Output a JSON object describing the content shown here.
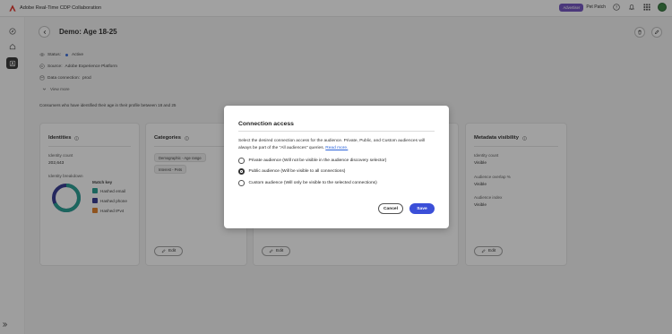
{
  "app": {
    "title": "Adobe Real-Time CDP Collaboration",
    "logo_icon": "adobe-logo-icon",
    "brand_color": "#e1251b"
  },
  "topbar": {
    "badge": "Advertiser",
    "org_name": "Pet Patch",
    "badge_color": "#6b4bbd"
  },
  "page": {
    "title": "Demo: Age 18-25",
    "status_label": "Status:",
    "status_value": "Active",
    "source_label": "Source:",
    "source_value": "Adobe Experience Platform",
    "connection_label": "Data connection:",
    "connection_value": "prod",
    "view_more": "View more",
    "description": "Consumers who have identified their age in their profile between 18 and 25"
  },
  "identities": {
    "title": "Identities",
    "count_label": "Identity count",
    "count_value": "202,643",
    "breakdown_label": "Identity breakdown",
    "match_key_label": "Match key",
    "legend": [
      {
        "label": "Hashed email",
        "color": "#1a9a8c"
      },
      {
        "label": "Hashed phone",
        "color": "#2a2f8c"
      },
      {
        "label": "Hashed IPv4",
        "color": "#e07a20"
      }
    ],
    "edit_label": ""
  },
  "categories": {
    "title": "Categories",
    "tags": [
      "Demographic - Age range",
      "Interest - Pets"
    ],
    "edit_label": "Edit"
  },
  "middle": {
    "edit_label": "Edit"
  },
  "metadata": {
    "title": "Metadata visibility",
    "rows": [
      {
        "label": "Identity count",
        "value": "Visible"
      },
      {
        "label": "Audience overlap %",
        "value": "Visible"
      },
      {
        "label": "Audience index",
        "value": "Visible"
      }
    ],
    "edit_label": "Edit"
  },
  "dialog": {
    "title": "Connection access",
    "body": "Select the desired connection access for the audience. Private, Public, and Custom audiences will always be part of the \"All audiences\" queries.",
    "link": "Read more.",
    "options": [
      {
        "label": "Private audience (Will not be visible in the audience discovery selector)",
        "checked": false
      },
      {
        "label": "Public audience (Will be visible to all connections)",
        "checked": true
      },
      {
        "label": "Custom audience (Will only be visible to the selected connections)",
        "checked": false
      }
    ],
    "cancel": "Cancel",
    "save": "Save",
    "save_color": "#3b4fd8"
  }
}
